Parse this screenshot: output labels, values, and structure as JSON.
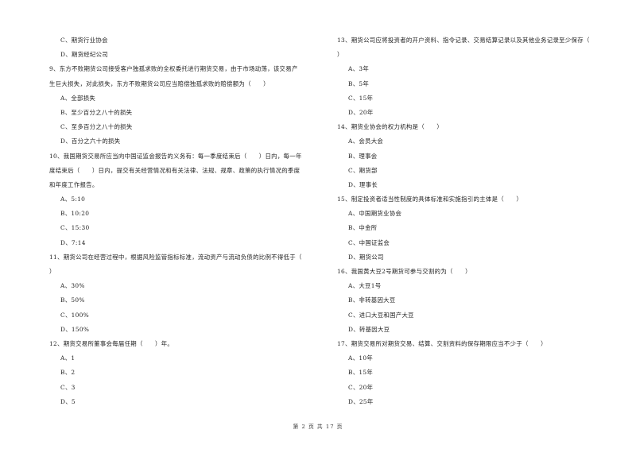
{
  "left_column": [
    {
      "type": "opt",
      "text": "C、期货行业协会"
    },
    {
      "type": "opt",
      "text": "D、期货经纪公司"
    },
    {
      "type": "q",
      "text": "9、东方不败期货公司接受客户独孤求败的全权委托进行期货交易，由于市场动荡，该交易产"
    },
    {
      "type": "q",
      "text": "生巨大损失，对此损失，东方不败期货公司应当赔偿独孤求败的赔偿额为（　　）"
    },
    {
      "type": "opt",
      "text": "A、全部损失"
    },
    {
      "type": "opt",
      "text": "B、至少百分之八十的损失"
    },
    {
      "type": "opt",
      "text": "C、至多百分之八十的损失"
    },
    {
      "type": "opt",
      "text": "D、百分之六十的损失"
    },
    {
      "type": "q",
      "text": "10、我国期货交易所应当向中国证监会报告的义务有：每一季度结束后（　　）日内，每一年"
    },
    {
      "type": "q",
      "text": "度结束后（　　）日内，提交有关经营情况和有关法律、法规、规章、政策的执行情况的季度"
    },
    {
      "type": "q",
      "text": "和年度工作报告。"
    },
    {
      "type": "opt",
      "text": "A、5:10"
    },
    {
      "type": "opt",
      "text": "B、10:20"
    },
    {
      "type": "opt",
      "text": "C、15:30"
    },
    {
      "type": "opt",
      "text": "D、7:14"
    },
    {
      "type": "q",
      "text": "11、期货公司在经营过程中，根据风险监管指标标准，流动资产与流动负债的比例不得低于（"
    },
    {
      "type": "q",
      "text": "）"
    },
    {
      "type": "opt",
      "text": "A、30%"
    },
    {
      "type": "opt",
      "text": "B、50%"
    },
    {
      "type": "opt",
      "text": "C、100%"
    },
    {
      "type": "opt",
      "text": "D、150%"
    },
    {
      "type": "q",
      "text": "12、期货交易所董事会每届任期（　　）年。"
    },
    {
      "type": "opt",
      "text": "A、1"
    },
    {
      "type": "opt",
      "text": "B、2"
    },
    {
      "type": "opt",
      "text": "C、3"
    },
    {
      "type": "opt",
      "text": "D、5"
    }
  ],
  "right_column": [
    {
      "type": "q",
      "text": "13、期货公司应将投资者的开户资料、指令记录、交易结算记录以及其他业务记录至少保存（"
    },
    {
      "type": "q",
      "text": "）"
    },
    {
      "type": "opt",
      "text": "A、3年"
    },
    {
      "type": "opt",
      "text": "B、5年"
    },
    {
      "type": "opt",
      "text": "C、15年"
    },
    {
      "type": "opt",
      "text": "D、20年"
    },
    {
      "type": "q",
      "text": "14、期货业协会的权力机构是（　　）"
    },
    {
      "type": "opt",
      "text": "A、会员大会"
    },
    {
      "type": "opt",
      "text": "B、理事会"
    },
    {
      "type": "opt",
      "text": "C、期货部"
    },
    {
      "type": "opt",
      "text": "D、理事长"
    },
    {
      "type": "q",
      "text": "15、制定投资者适当性制度的具体标准和实施指引的主体是（　　）"
    },
    {
      "type": "opt",
      "text": "A、中国期货业协会"
    },
    {
      "type": "opt",
      "text": "B、中金所"
    },
    {
      "type": "opt",
      "text": "C、中国证监会"
    },
    {
      "type": "opt",
      "text": "D、期货公司"
    },
    {
      "type": "q",
      "text": "16、我国黄大豆2号期货可参与交割的为（　　）"
    },
    {
      "type": "opt",
      "text": "A、大豆1号"
    },
    {
      "type": "opt",
      "text": "B、非转基因大豆"
    },
    {
      "type": "opt",
      "text": "C、进口大豆和国产大豆"
    },
    {
      "type": "opt",
      "text": "D、转基因大豆"
    },
    {
      "type": "q",
      "text": "17、期货交易所对期货交易、结算、交割资料的保存期限应当不少于（　　）"
    },
    {
      "type": "opt",
      "text": "A、10年"
    },
    {
      "type": "opt",
      "text": "B、15年"
    },
    {
      "type": "opt",
      "text": "C、20年"
    },
    {
      "type": "opt",
      "text": "D、25年"
    }
  ],
  "footer": {
    "page_label": "第 2 页 共 17 页"
  }
}
